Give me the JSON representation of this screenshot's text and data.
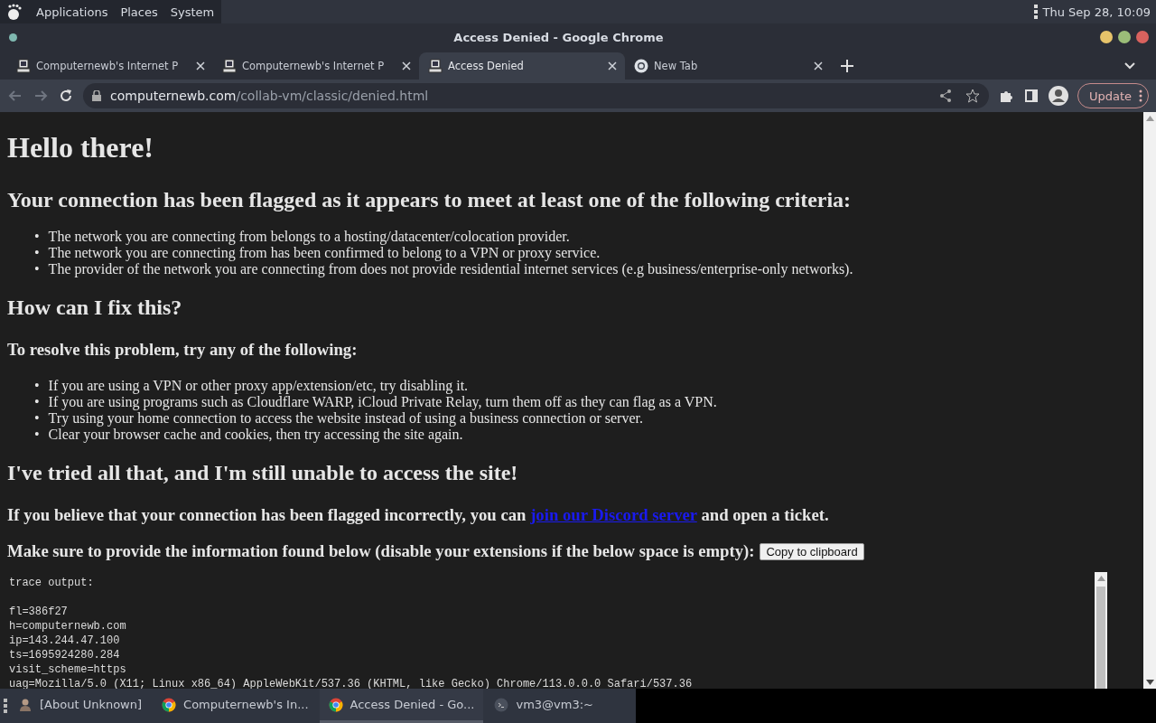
{
  "top_panel": {
    "menus": [
      "Applications",
      "Places",
      "System"
    ],
    "clock": "Thu Sep 28, 10:09"
  },
  "window": {
    "title": "Access Denied - Google Chrome"
  },
  "tabs": [
    {
      "title": "Computernewb's Internet P",
      "kind": "computer",
      "selected": false
    },
    {
      "title": "Computernewb's Internet P",
      "kind": "computer",
      "selected": false
    },
    {
      "title": "Access Denied",
      "kind": "computer",
      "selected": true
    },
    {
      "title": "New Tab",
      "kind": "chrome",
      "selected": false
    }
  ],
  "address": {
    "domain": "computernewb.com",
    "path": "/collab-vm/classic/denied.html"
  },
  "update_button": "Update",
  "page": {
    "title": "Hello there!",
    "bullet": "•",
    "criteria_heading": "Your connection has been flagged as it appears to meet at least one of the following criteria:",
    "criteria": [
      "The network you are connecting from belongs to a hosting/datacenter/colocation provider.",
      "The network you are connecting from has been confirmed to belong to a VPN or proxy service.",
      "The provider of the network you are connecting from does not provide residential internet services (e.g business/enterprise-only networks)."
    ],
    "fix_heading": "How can I fix this?",
    "fix_subheading": "To resolve this problem, try any of the following:",
    "fixes": [
      "If you are using a VPN or other proxy app/extension/etc, try disabling it.",
      "If you are using programs such as Cloudflare WARP, iCloud Private Relay, turn them off as they can flag as a VPN.",
      "Try using your home connection to access the website instead of using a business connection or server.",
      "Clear your browser cache and cookies, then try accessing the site again."
    ],
    "tried_heading": "I've tried all that, and I'm still unable to access the site!",
    "ticket_before": "If you believe that your connection has been flagged incorrectly, you can ",
    "ticket_link": "join our Discord server",
    "ticket_after": " and open a ticket.",
    "info_text": "Make sure to provide the information found below (disable your extensions if the below space is empty):",
    "copy_button": "Copy to clipboard",
    "trace_header": "trace output:",
    "trace_lines": [
      "fl=386f27",
      "h=computernewb.com",
      "ip=143.244.47.100",
      "ts=1695924280.284",
      "visit_scheme=https",
      "uag=Mozilla/5.0 (X11; Linux x86_64) AppleWebKit/537.36 (KHTML, like Gecko) Chrome/113.0.0.0 Safari/537.36"
    ]
  },
  "taskbar": [
    {
      "label": "[About Unknown]",
      "kind": "user",
      "selected": false
    },
    {
      "label": "Computernewb's In...",
      "kind": "chrome",
      "selected": false
    },
    {
      "label": "Access Denied - Go...",
      "kind": "chrome",
      "selected": true
    },
    {
      "label": "vm3@vm3:~",
      "kind": "terminal",
      "selected": false
    }
  ]
}
